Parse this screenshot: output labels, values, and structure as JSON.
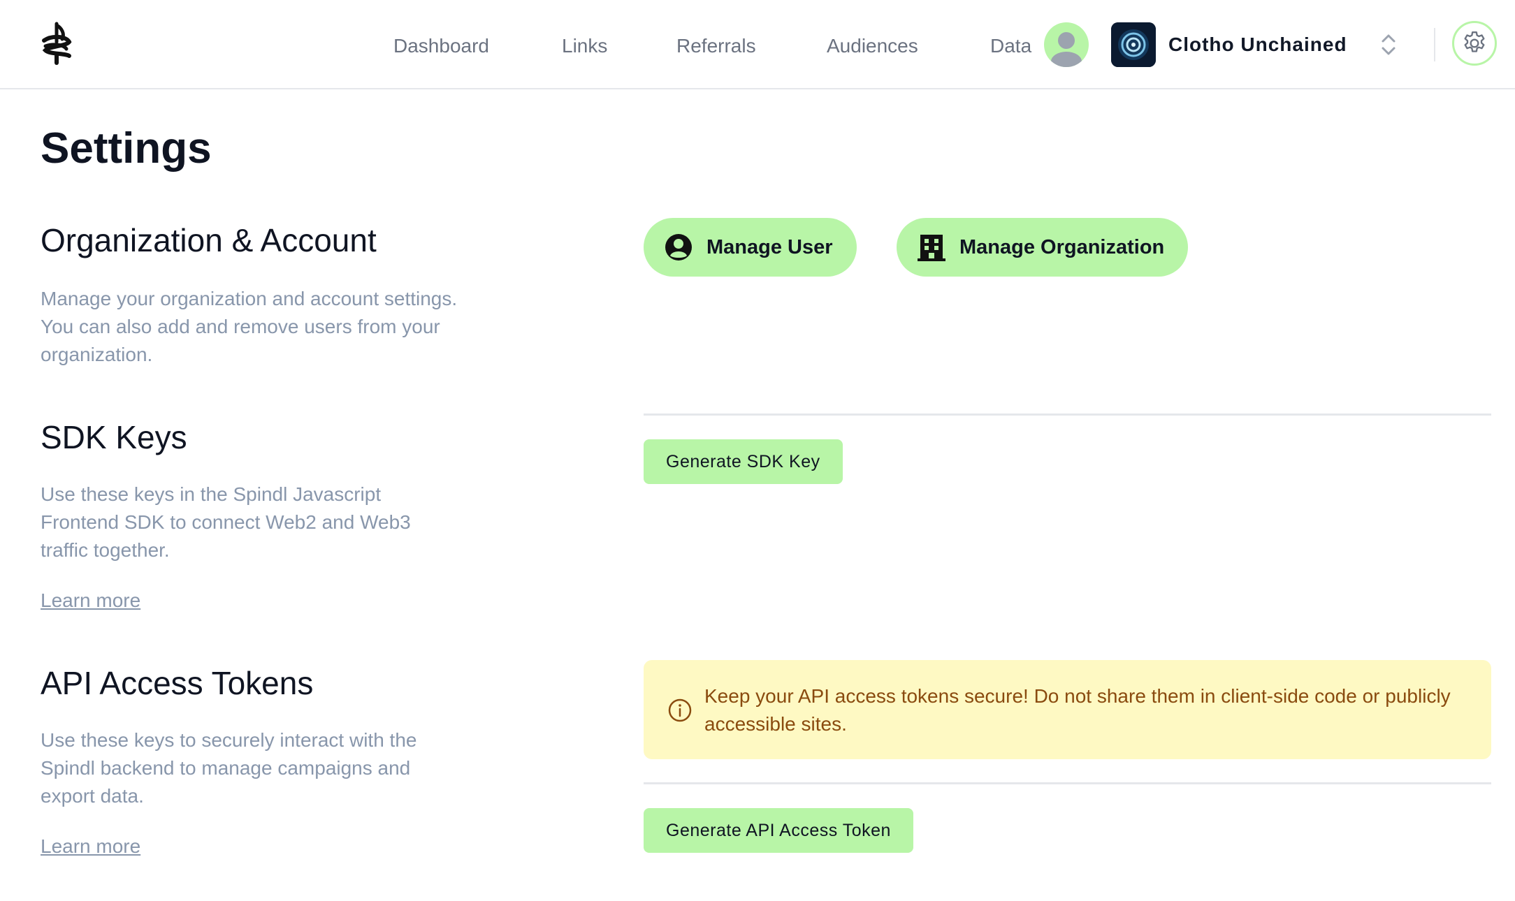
{
  "header": {
    "nav": [
      {
        "label": "Dashboard"
      },
      {
        "label": "Links"
      },
      {
        "label": "Referrals"
      },
      {
        "label": "Audiences"
      },
      {
        "label": "Data"
      }
    ],
    "org_name": "Clotho Unchained",
    "icons": {
      "logo": "spindl-logo-icon",
      "avatar": "user-avatar-icon",
      "switcher": "chevron-up-down-icon",
      "settings": "gear-icon"
    },
    "accent_color": "#b8f5a7"
  },
  "page": {
    "title": "Settings"
  },
  "sections": {
    "org": {
      "title": "Organization & Account",
      "description": "Manage your organization and account settings. You can also add and remove users from your organization.",
      "manage_user_label": "Manage User",
      "manage_org_label": "Manage Organization"
    },
    "sdk": {
      "title": "SDK Keys",
      "description": "Use these keys in the Spindl Javascript Frontend SDK to connect Web2 and Web3 traffic together.",
      "learn_more": "Learn more",
      "generate_label": "Generate SDK Key"
    },
    "api": {
      "title": "API Access Tokens",
      "description": "Use these keys to securely interact with the Spindl backend to manage campaigns and export data.",
      "learn_more": "Learn more",
      "alert_text": "Keep your API access tokens secure! Do not share them in client-side code or publicly accessible sites.",
      "alert_color": "#fef9c3",
      "generate_label": "Generate API Access Token"
    }
  }
}
